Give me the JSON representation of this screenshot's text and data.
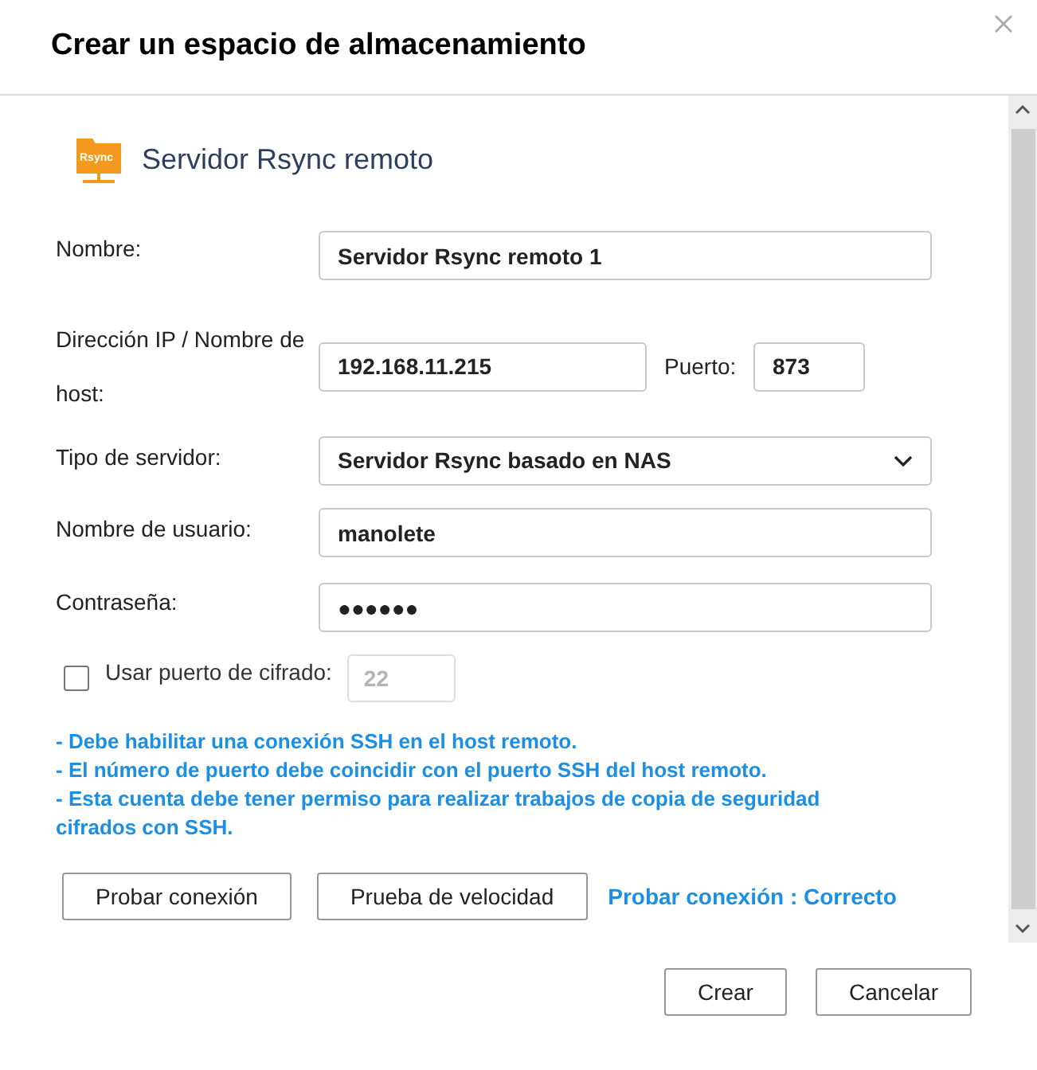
{
  "window": {
    "title": "Crear un espacio de almacenamiento"
  },
  "section": {
    "icon_label": "Rsync",
    "title": "Servidor Rsync remoto"
  },
  "fields": {
    "name": {
      "label": "Nombre:",
      "value": "Servidor Rsync remoto 1"
    },
    "host": {
      "label": "Dirección IP / Nombre de host:",
      "value": "192.168.11.215"
    },
    "port": {
      "label": "Puerto:",
      "value": "873"
    },
    "server_type": {
      "label": "Tipo de servidor:",
      "value": "Servidor Rsync basado en NAS"
    },
    "username": {
      "label": "Nombre de usuario:",
      "value": "manolete"
    },
    "password": {
      "label": "Contraseña:",
      "value": "●●●●●●"
    },
    "encryption_port": {
      "label": "Usar puerto de cifrado:",
      "checked": false,
      "placeholder": "22",
      "disabled": true
    }
  },
  "notes": [
    "- Debe habilitar una conexión SSH en el host remoto.",
    "- El número de puerto debe coincidir con el puerto SSH del host remoto.",
    "- Esta cuenta debe tener permiso para realizar trabajos de copia de seguridad cifrados con SSH."
  ],
  "test_buttons": [
    "Probar conexión",
    "Prueba de velocidad"
  ],
  "test_result": "Probar conexión : Correcto",
  "footer_buttons": [
    "Crear",
    "Cancelar"
  ]
}
